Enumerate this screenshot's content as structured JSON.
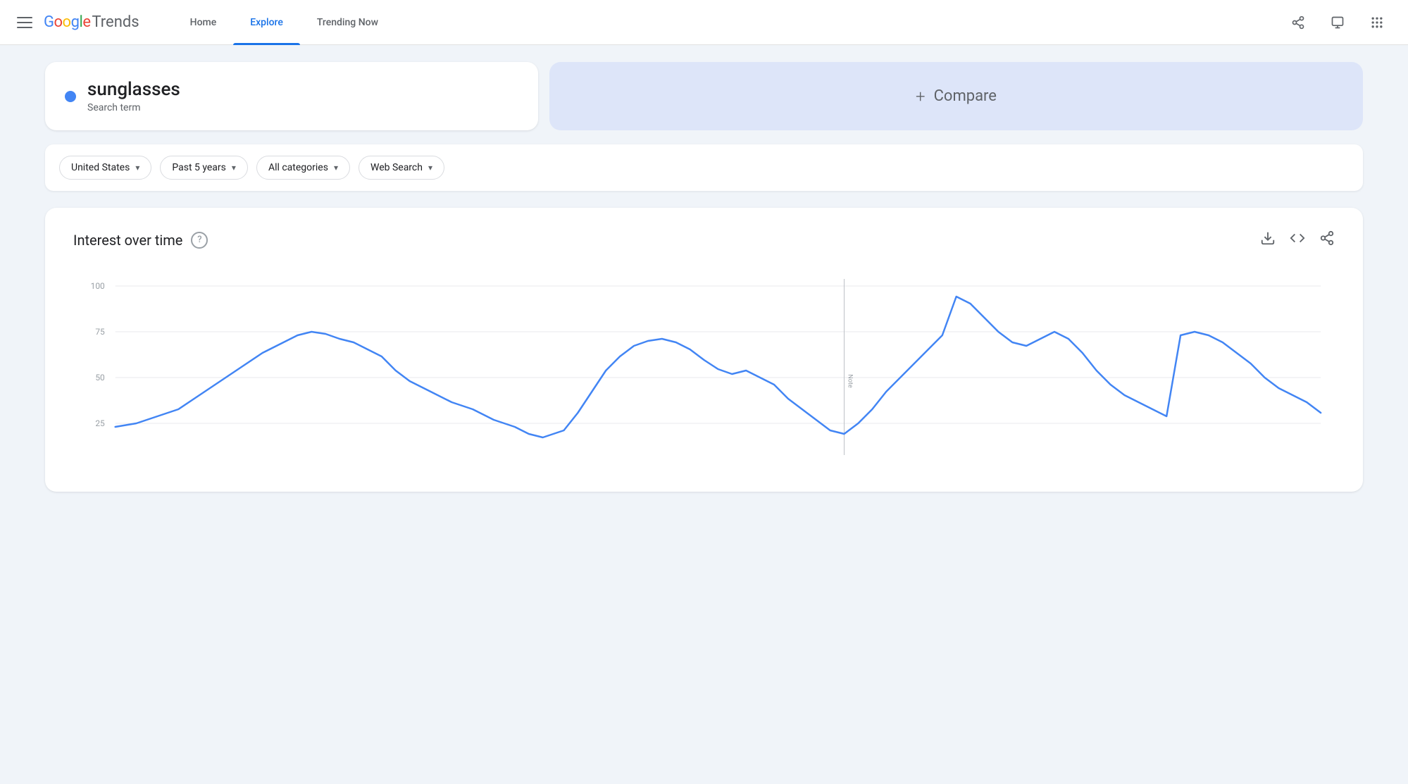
{
  "header": {
    "menu_icon": "☰",
    "logo_google": "Google",
    "logo_trends": "Trends",
    "nav": [
      {
        "label": "Home",
        "active": false
      },
      {
        "label": "Explore",
        "active": true
      },
      {
        "label": "Trending Now",
        "active": false
      }
    ],
    "actions": [
      {
        "name": "share-icon",
        "glyph": "⎋",
        "label": "Share"
      },
      {
        "name": "feedback-icon",
        "glyph": "⊡",
        "label": "Feedback"
      },
      {
        "name": "apps-icon",
        "glyph": "⠿",
        "label": "Apps"
      }
    ]
  },
  "search": {
    "term": "sunglasses",
    "type": "Search term",
    "dot_color": "#4285f4"
  },
  "compare": {
    "plus": "+",
    "label": "Compare"
  },
  "filters": [
    {
      "label": "United States",
      "name": "region-filter"
    },
    {
      "label": "Past 5 years",
      "name": "time-filter"
    },
    {
      "label": "All categories",
      "name": "category-filter"
    },
    {
      "label": "Web Search",
      "name": "search-type-filter"
    }
  ],
  "chart": {
    "title": "Interest over time",
    "y_labels": [
      "100",
      "75",
      "50",
      "25"
    ],
    "note": "Note",
    "actions": [
      {
        "name": "download-icon",
        "glyph": "⬇"
      },
      {
        "name": "embed-icon",
        "glyph": "<>"
      },
      {
        "name": "chart-share-icon",
        "glyph": "⎋"
      }
    ]
  }
}
